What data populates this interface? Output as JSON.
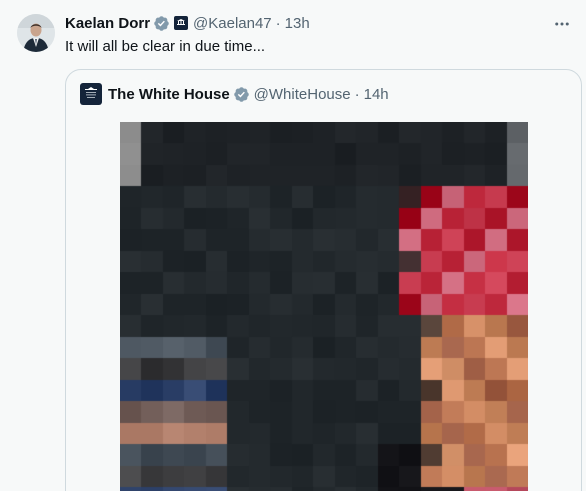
{
  "post": {
    "author_name": "Kaelan Dorr",
    "handle": "@Kaelan47",
    "separator": "·",
    "time": "13h",
    "text": "It will all be clear in due time..."
  },
  "quoted_post": {
    "author_name": "The White House",
    "handle": "@WhiteHouse",
    "separator": "·",
    "time": "14h",
    "avatar_text": "THE WHITE HOUSE"
  },
  "icons": {
    "verified": "verified-badge-icon",
    "affiliation": "affiliation-badge-icon",
    "more": "more-options-icon"
  },
  "colors": {
    "verified_badge": "#829aab",
    "text_primary": "#0f1419",
    "text_secondary": "#536471",
    "border": "#cfd9de",
    "background": "#f7f9f9"
  }
}
